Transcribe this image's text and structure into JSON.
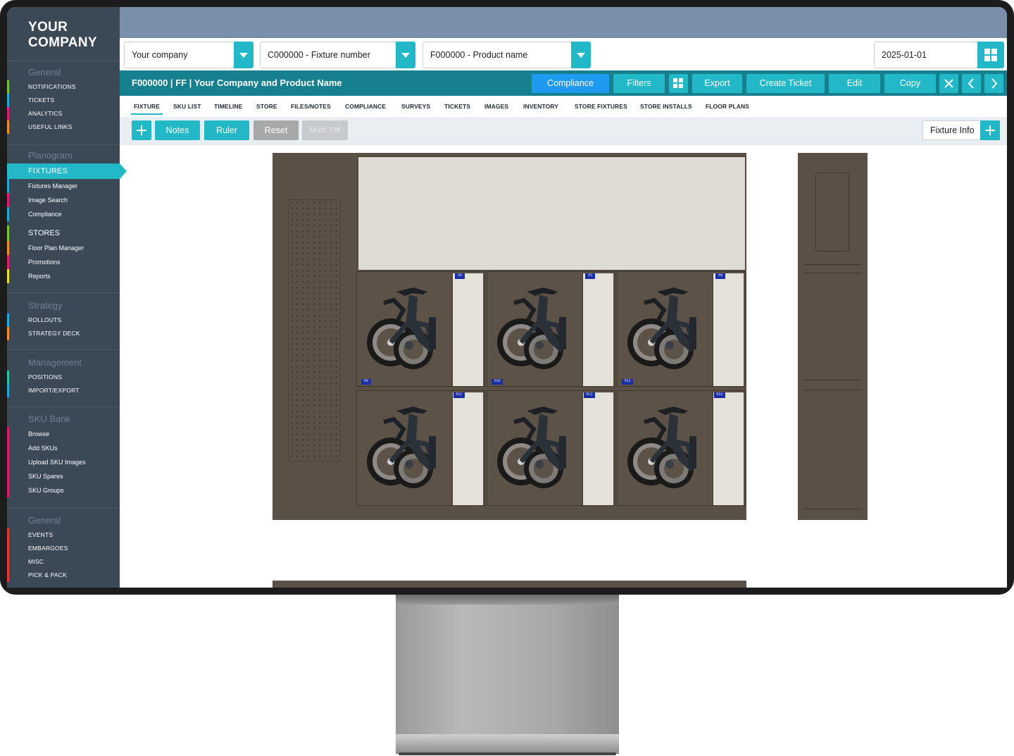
{
  "brand": {
    "line1": "YOUR",
    "line2": "COMPANY"
  },
  "sidebar": {
    "sections": [
      {
        "heading": "General",
        "items": [
          "NOTIFICATIONS",
          "TICKETS",
          "ANALYTICS",
          "USEFUL LINKS"
        ]
      },
      {
        "heading": "Planogram",
        "items": [
          "FIXTURES",
          "Fixtures Manager",
          "Image Search",
          "Compliance",
          "STORES",
          "Floor Plan Manager",
          "Promotions",
          "Reports"
        ]
      },
      {
        "heading": "Strategy",
        "items": [
          "ROLLOUTS",
          "STRATEGY DECK"
        ]
      },
      {
        "heading": "Management",
        "items": [
          "POSITIONS",
          "IMPORT/EXPORT"
        ]
      },
      {
        "heading": "SKU Bank",
        "items": [
          "Browse",
          "Add SKUs",
          "Upload SKU Images",
          "SKU Spares",
          "SKU Groups"
        ]
      },
      {
        "heading": "General",
        "items": [
          "EVENTS",
          "EMBARGOES",
          "MISC",
          "PICK & PACK"
        ]
      }
    ],
    "active_item": "FIXTURES"
  },
  "selectors": {
    "company": "Your company",
    "fixture": "C000000 - Fixture number",
    "product": "F000000 - Product name",
    "date": "2025-01-01"
  },
  "titlebar": {
    "title": "F000000 | FF | Your Company and Product Name",
    "buttons": [
      "Compliance",
      "Filters",
      "Export",
      "Create Ticket",
      "Edit",
      "Copy"
    ]
  },
  "tabs": [
    "FIXTURE",
    "SKU LIST",
    "TIMELINE",
    "STORE",
    "FILES/NOTES",
    "COMPLIANCE",
    "SURVEYS",
    "TICKETS",
    "IMAGES",
    "INVENTORY",
    "STORE FIXTURES",
    "STORE INSTALLS",
    "FLOOR PLANS"
  ],
  "toolbar": {
    "notes": "Notes",
    "ruler": "Ruler",
    "reset": "Reset",
    "multi": "Multi: Off",
    "fixture_info": "Fixture Info"
  },
  "planogram": {
    "top_tags": [
      "P4",
      "P5",
      "P8"
    ],
    "top_bottom_tags": [
      "P9",
      "P10",
      "P11"
    ],
    "bottom_tags": [
      "P12",
      "P13",
      "P14"
    ]
  },
  "colors": {
    "accent": "#22b8c8",
    "accent_dark": "#16808e",
    "compliance_blue": "#1e9af0",
    "sidebar": "#3b4856",
    "topbar": "#7a8faa"
  }
}
